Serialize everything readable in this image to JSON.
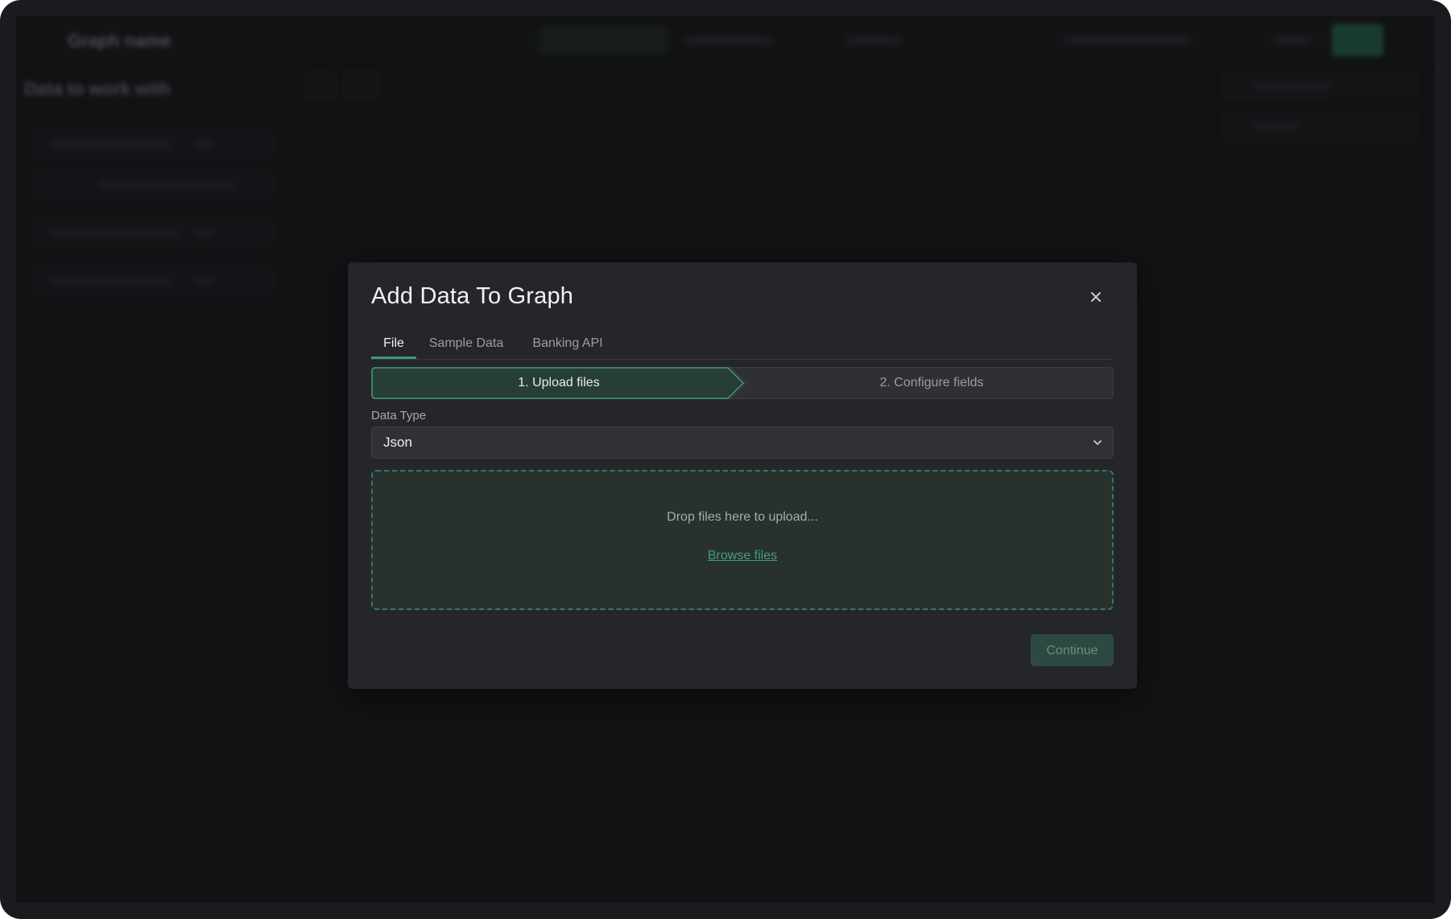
{
  "modal": {
    "title": "Add Data To Graph",
    "tabs": [
      {
        "label": "File",
        "active": true
      },
      {
        "label": "Sample Data",
        "active": false
      },
      {
        "label": "Banking API",
        "active": false
      }
    ],
    "steps": [
      {
        "label": "1. Upload files",
        "active": true
      },
      {
        "label": "2. Configure fields",
        "active": false
      }
    ],
    "data_type": {
      "label": "Data Type",
      "value": "Json"
    },
    "dropzone": {
      "text": "Drop files here to upload...",
      "browse_label": "Browse files"
    },
    "continue_label": "Continue"
  },
  "background": {
    "app_title": "Graph name",
    "sidebar_title": "Data to work with",
    "dimmed": true
  },
  "colors": {
    "accent": "#3d9b78",
    "modal_bg": "#25262b",
    "dropzone_bg": "#29312f",
    "continue_bg": "#2c4a41"
  }
}
